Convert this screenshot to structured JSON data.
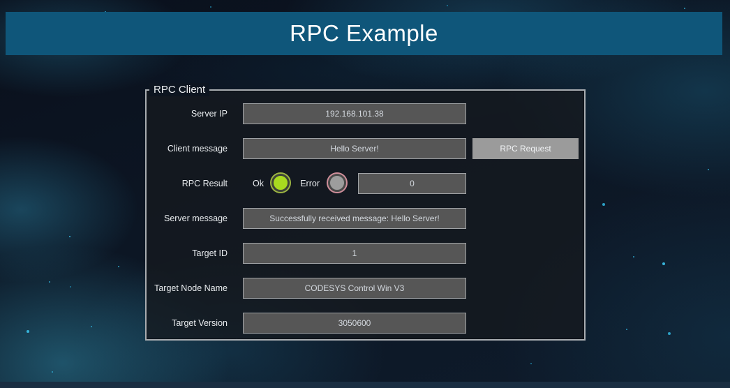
{
  "header": {
    "title": "RPC Example"
  },
  "panel": {
    "legend": "RPC Client",
    "rows": [
      {
        "label": "Server IP",
        "value": "192.168.101.38"
      },
      {
        "label": "Client message",
        "value": "Hello Server!"
      },
      {
        "label": "Server message",
        "value": "Successfully received message: Hello Server!"
      },
      {
        "label": "Target ID",
        "value": "1"
      },
      {
        "label": "Target Node Name",
        "value": "CODESYS Control Win V3"
      },
      {
        "label": "Target Version",
        "value": "3050600"
      }
    ],
    "result": {
      "label": "RPC Result",
      "ok_label": "Ok",
      "error_label": "Error",
      "value": "0",
      "ok_led_on": true,
      "error_led_on": false
    },
    "request_button": {
      "label": "RPC Request"
    }
  },
  "colors": {
    "header_bg": "#0f567a",
    "panel_border": "#a9adb1",
    "field_bg": "#565656",
    "field_border": "#a0a3a6",
    "button_bg": "#9b9b9b",
    "led_ok_on": "#a8da1f",
    "led_error_off": "#9d9d9d",
    "led_error_ring": "#cf8e9a"
  }
}
